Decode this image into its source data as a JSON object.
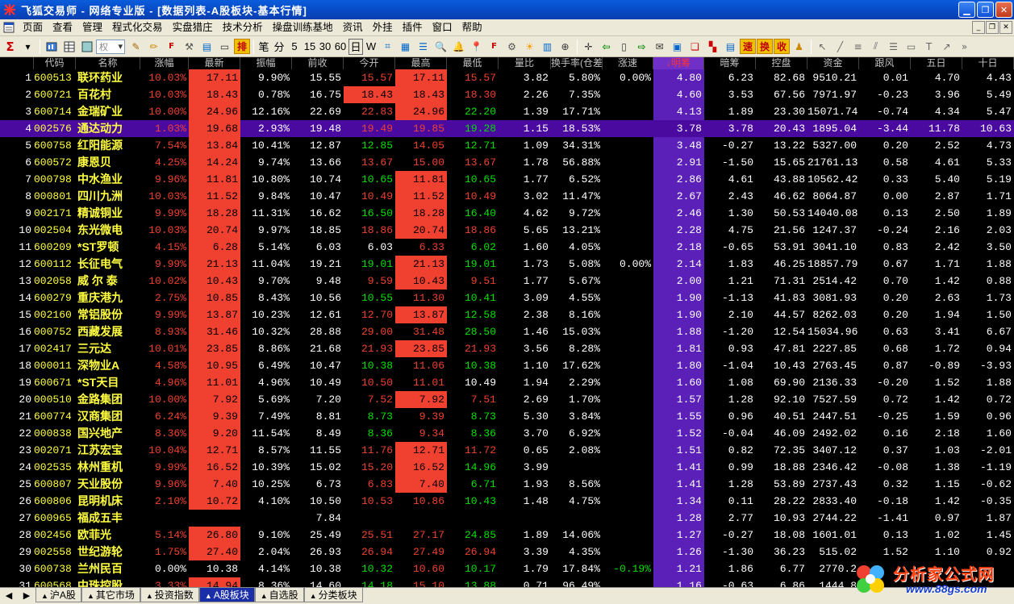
{
  "window": {
    "title": "飞狐交易师 - 网络专业版 - [数据列表-A股板块-基本行情]"
  },
  "menu": [
    "页面",
    "查看",
    "管理",
    "程式化交易",
    "实盘猎庄",
    "技术分析",
    "操盘训练基地",
    "资讯",
    "外挂",
    "插件",
    "窗口",
    "帮助"
  ],
  "toolbar": {
    "dropdown_placeholder": "权",
    "period_buttons": [
      "笔",
      "分",
      "5",
      "15",
      "30",
      "60",
      "日",
      "W"
    ],
    "red_buttons": [
      "排",
      "速",
      "换",
      "收"
    ]
  },
  "colors": {
    "up": "#f04030",
    "down": "#00e000",
    "flat": "#ffffff",
    "name": "#ffff40",
    "sorted_header_bg": "#7030c8",
    "selected_row_bg": "#4a0aa0"
  },
  "columns": [
    {
      "key": "idx",
      "label": ""
    },
    {
      "key": "code",
      "label": "代码"
    },
    {
      "key": "name",
      "label": "名称"
    },
    {
      "key": "chg",
      "label": "涨幅"
    },
    {
      "key": "last",
      "label": "最新"
    },
    {
      "key": "amp",
      "label": "振幅"
    },
    {
      "key": "prev",
      "label": "前收"
    },
    {
      "key": "open",
      "label": "今开"
    },
    {
      "key": "high",
      "label": "最高"
    },
    {
      "key": "low",
      "label": "最低"
    },
    {
      "key": "vr",
      "label": "量比"
    },
    {
      "key": "turn",
      "label": "换手率(仓差"
    },
    {
      "key": "spd",
      "label": "涨速"
    },
    {
      "key": "mc",
      "label": "↓明筹"
    },
    {
      "key": "ac",
      "label": "暗筹"
    },
    {
      "key": "ctrl",
      "label": "控盘"
    },
    {
      "key": "fund",
      "label": "资金"
    },
    {
      "key": "fw",
      "label": "跟风"
    },
    {
      "key": "d5",
      "label": "五日"
    },
    {
      "key": "d10",
      "label": "十日"
    }
  ],
  "rows": [
    [
      "1",
      "600513",
      "联环药业",
      "10.03%",
      "17.11",
      "9.90%",
      "15.55",
      "15.57",
      "17.11",
      "15.57",
      "3.82",
      "5.80%",
      "0.00%",
      "4.80",
      "6.23",
      "82.68",
      "9510.21",
      "0.01",
      "4.70",
      "4.43"
    ],
    [
      "2",
      "600721",
      "百花村",
      "10.03%",
      "18.43",
      "0.78%",
      "16.75",
      "18.43",
      "18.43",
      "18.30",
      "2.26",
      "7.35%",
      "",
      "4.60",
      "3.53",
      "67.56",
      "7971.97",
      "-0.23",
      "3.96",
      "5.49"
    ],
    [
      "3",
      "600714",
      "金瑞矿业",
      "10.00%",
      "24.96",
      "12.16%",
      "22.69",
      "22.83",
      "24.96",
      "22.20",
      "1.39",
      "17.71%",
      "",
      "4.13",
      "1.89",
      "23.30",
      "15071.74",
      "-0.74",
      "4.34",
      "5.47"
    ],
    [
      "4",
      "002576",
      "通达动力",
      "1.03%",
      "19.68",
      "2.93%",
      "19.48",
      "19.49",
      "19.85",
      "19.28",
      "1.15",
      "18.53%",
      "",
      "3.78",
      "3.78",
      "20.43",
      "1895.04",
      "-3.44",
      "11.78",
      "10.63"
    ],
    [
      "5",
      "600758",
      "红阳能源",
      "7.54%",
      "13.84",
      "10.41%",
      "12.87",
      "12.85",
      "14.05",
      "12.71",
      "1.09",
      "34.31%",
      "",
      "3.48",
      "-0.27",
      "13.22",
      "5327.00",
      "0.20",
      "2.52",
      "4.73"
    ],
    [
      "6",
      "600572",
      "康恩贝",
      "4.25%",
      "14.24",
      "9.74%",
      "13.66",
      "13.67",
      "15.00",
      "13.67",
      "1.78",
      "56.88%",
      "",
      "2.91",
      "-1.50",
      "15.65",
      "21761.13",
      "0.58",
      "4.61",
      "5.33"
    ],
    [
      "7",
      "000798",
      "中水渔业",
      "9.96%",
      "11.81",
      "10.80%",
      "10.74",
      "10.65",
      "11.81",
      "10.65",
      "1.77",
      "6.52%",
      "",
      "2.86",
      "4.61",
      "43.88",
      "10562.42",
      "0.33",
      "5.40",
      "5.19"
    ],
    [
      "8",
      "000801",
      "四川九洲",
      "10.03%",
      "11.52",
      "9.84%",
      "10.47",
      "10.49",
      "11.52",
      "10.49",
      "3.02",
      "11.47%",
      "",
      "2.67",
      "2.43",
      "46.62",
      "8064.87",
      "0.00",
      "2.87",
      "1.71"
    ],
    [
      "9",
      "002171",
      "精诚铜业",
      "9.99%",
      "18.28",
      "11.31%",
      "16.62",
      "16.50",
      "18.28",
      "16.40",
      "4.62",
      "9.72%",
      "",
      "2.46",
      "1.30",
      "50.53",
      "14040.08",
      "0.13",
      "2.50",
      "1.89"
    ],
    [
      "10",
      "002504",
      "东光微电",
      "10.03%",
      "20.74",
      "9.97%",
      "18.85",
      "18.86",
      "20.74",
      "18.86",
      "5.65",
      "13.21%",
      "",
      "2.28",
      "4.75",
      "21.56",
      "1247.37",
      "-0.24",
      "2.16",
      "2.03"
    ],
    [
      "11",
      "600209",
      "*ST罗顿",
      "4.15%",
      "6.28",
      "5.14%",
      "6.03",
      "6.03",
      "6.33",
      "6.02",
      "1.60",
      "4.05%",
      "",
      "2.18",
      "-0.65",
      "53.91",
      "3041.10",
      "0.83",
      "2.42",
      "3.50"
    ],
    [
      "12",
      "600112",
      "长征电气",
      "9.99%",
      "21.13",
      "11.04%",
      "19.21",
      "19.01",
      "21.13",
      "19.01",
      "1.73",
      "5.08%",
      "0.00%",
      "2.14",
      "1.83",
      "46.25",
      "18857.79",
      "0.67",
      "1.71",
      "1.88"
    ],
    [
      "13",
      "002058",
      "威 尔 泰",
      "10.02%",
      "10.43",
      "9.70%",
      "9.48",
      "9.59",
      "10.43",
      "9.51",
      "1.77",
      "5.67%",
      "",
      "2.00",
      "1.21",
      "71.31",
      "2514.42",
      "0.70",
      "1.42",
      "0.88"
    ],
    [
      "14",
      "600279",
      "重庆港九",
      "2.75%",
      "10.85",
      "8.43%",
      "10.56",
      "10.55",
      "11.30",
      "10.41",
      "3.09",
      "4.55%",
      "",
      "1.90",
      "-1.13",
      "41.83",
      "3081.93",
      "0.20",
      "2.63",
      "1.73"
    ],
    [
      "15",
      "002160",
      "常铝股份",
      "9.99%",
      "13.87",
      "10.23%",
      "12.61",
      "12.70",
      "13.87",
      "12.58",
      "2.38",
      "8.16%",
      "",
      "1.90",
      "2.10",
      "44.57",
      "8262.03",
      "0.20",
      "1.94",
      "1.50"
    ],
    [
      "16",
      "000752",
      "西藏发展",
      "8.93%",
      "31.46",
      "10.32%",
      "28.88",
      "29.00",
      "31.48",
      "28.50",
      "1.46",
      "15.03%",
      "",
      "1.88",
      "-1.20",
      "12.54",
      "15034.96",
      "0.63",
      "3.41",
      "6.67"
    ],
    [
      "17",
      "002417",
      "三元达",
      "10.01%",
      "23.85",
      "8.86%",
      "21.68",
      "21.93",
      "23.85",
      "21.93",
      "3.56",
      "8.28%",
      "",
      "1.81",
      "0.93",
      "47.81",
      "2227.85",
      "0.68",
      "1.72",
      "0.94"
    ],
    [
      "18",
      "000011",
      "深物业A",
      "4.58%",
      "10.95",
      "6.49%",
      "10.47",
      "10.38",
      "11.06",
      "10.38",
      "1.10",
      "17.62%",
      "",
      "1.80",
      "-1.04",
      "10.43",
      "2763.45",
      "0.87",
      "-0.89",
      "-3.93"
    ],
    [
      "19",
      "600671",
      "*ST天目",
      "4.96%",
      "11.01",
      "4.96%",
      "10.49",
      "10.50",
      "11.01",
      "10.49",
      "1.94",
      "2.29%",
      "",
      "1.60",
      "1.08",
      "69.90",
      "2136.33",
      "-0.20",
      "1.52",
      "1.88"
    ],
    [
      "20",
      "000510",
      "金路集团",
      "10.00%",
      "7.92",
      "5.69%",
      "7.20",
      "7.52",
      "7.92",
      "7.51",
      "2.69",
      "1.70%",
      "",
      "1.57",
      "1.28",
      "92.10",
      "7527.59",
      "0.72",
      "1.42",
      "0.72"
    ],
    [
      "21",
      "600774",
      "汉商集团",
      "6.24%",
      "9.39",
      "7.49%",
      "8.81",
      "8.73",
      "9.39",
      "8.73",
      "5.30",
      "3.84%",
      "",
      "1.55",
      "0.96",
      "40.51",
      "2447.51",
      "-0.25",
      "1.59",
      "0.96"
    ],
    [
      "22",
      "000838",
      "国兴地产",
      "8.36%",
      "9.20",
      "11.54%",
      "8.49",
      "8.36",
      "9.34",
      "8.36",
      "3.70",
      "6.92%",
      "",
      "1.52",
      "-0.04",
      "46.09",
      "2492.02",
      "0.16",
      "2.18",
      "1.60"
    ],
    [
      "23",
      "002071",
      "江苏宏宝",
      "10.04%",
      "12.71",
      "8.57%",
      "11.55",
      "11.76",
      "12.71",
      "11.72",
      "0.65",
      "2.08%",
      "",
      "1.51",
      "0.82",
      "72.35",
      "3407.12",
      "0.37",
      "1.03",
      "-2.01"
    ],
    [
      "24",
      "002535",
      "林州重机",
      "9.99%",
      "16.52",
      "10.39%",
      "15.02",
      "15.20",
      "16.52",
      "14.96",
      "3.99",
      "",
      "",
      "1.41",
      "0.99",
      "18.88",
      "2346.42",
      "-0.08",
      "1.38",
      "-1.19"
    ],
    [
      "25",
      "600807",
      "天业股份",
      "9.96%",
      "7.40",
      "10.25%",
      "6.73",
      "6.83",
      "7.40",
      "6.71",
      "1.93",
      "8.56%",
      "",
      "1.41",
      "1.28",
      "53.89",
      "2737.43",
      "0.32",
      "1.15",
      "-0.62"
    ],
    [
      "26",
      "600806",
      "昆明机床",
      "2.10%",
      "10.72",
      "4.10%",
      "10.50",
      "10.53",
      "10.86",
      "10.43",
      "1.48",
      "4.75%",
      "",
      "1.34",
      "0.11",
      "28.22",
      "2833.40",
      "-0.18",
      "1.42",
      "-0.35"
    ],
    [
      "27",
      "600965",
      "福成五丰",
      "",
      "",
      "",
      "7.84",
      "",
      "",
      "",
      "",
      "",
      "",
      "1.28",
      "2.77",
      "10.93",
      "2744.22",
      "-1.41",
      "0.97",
      "1.87"
    ],
    [
      "28",
      "002456",
      "欧菲光",
      "5.14%",
      "26.80",
      "9.10%",
      "25.49",
      "25.51",
      "27.17",
      "24.85",
      "1.89",
      "14.06%",
      "",
      "1.27",
      "-0.27",
      "18.08",
      "1601.01",
      "0.13",
      "1.02",
      "1.45"
    ],
    [
      "29",
      "002558",
      "世纪游轮",
      "1.75%",
      "27.40",
      "2.04%",
      "26.93",
      "26.94",
      "27.49",
      "26.94",
      "3.39",
      "4.35%",
      "",
      "1.26",
      "-1.30",
      "36.23",
      "515.02",
      "1.52",
      "1.10",
      "0.92"
    ],
    [
      "30",
      "600738",
      "兰州民百",
      "0.00%",
      "10.38",
      "4.14%",
      "10.38",
      "10.32",
      "10.60",
      "10.17",
      "1.79",
      "17.84%",
      "-0.19%",
      "1.21",
      "1.86",
      "6.77",
      "2770.2",
      "",
      "",
      ""
    ],
    [
      "31",
      "600568",
      "中珠控股",
      "3.33%",
      "14.94",
      "8.36%",
      "14.60",
      "14.18",
      "15.10",
      "13.88",
      "0.71",
      "96.49%",
      "",
      "1.16",
      "-0.63",
      "6.86",
      "1444.8",
      "",
      "",
      ""
    ]
  ],
  "tabs": [
    "沪A股",
    "其它市场",
    "投资指数",
    "A股板块",
    "自选股",
    "分类板块"
  ],
  "active_tab": "A股板块",
  "watermark": {
    "line1": "分析家公式网",
    "line2": "www.88gs.com"
  }
}
